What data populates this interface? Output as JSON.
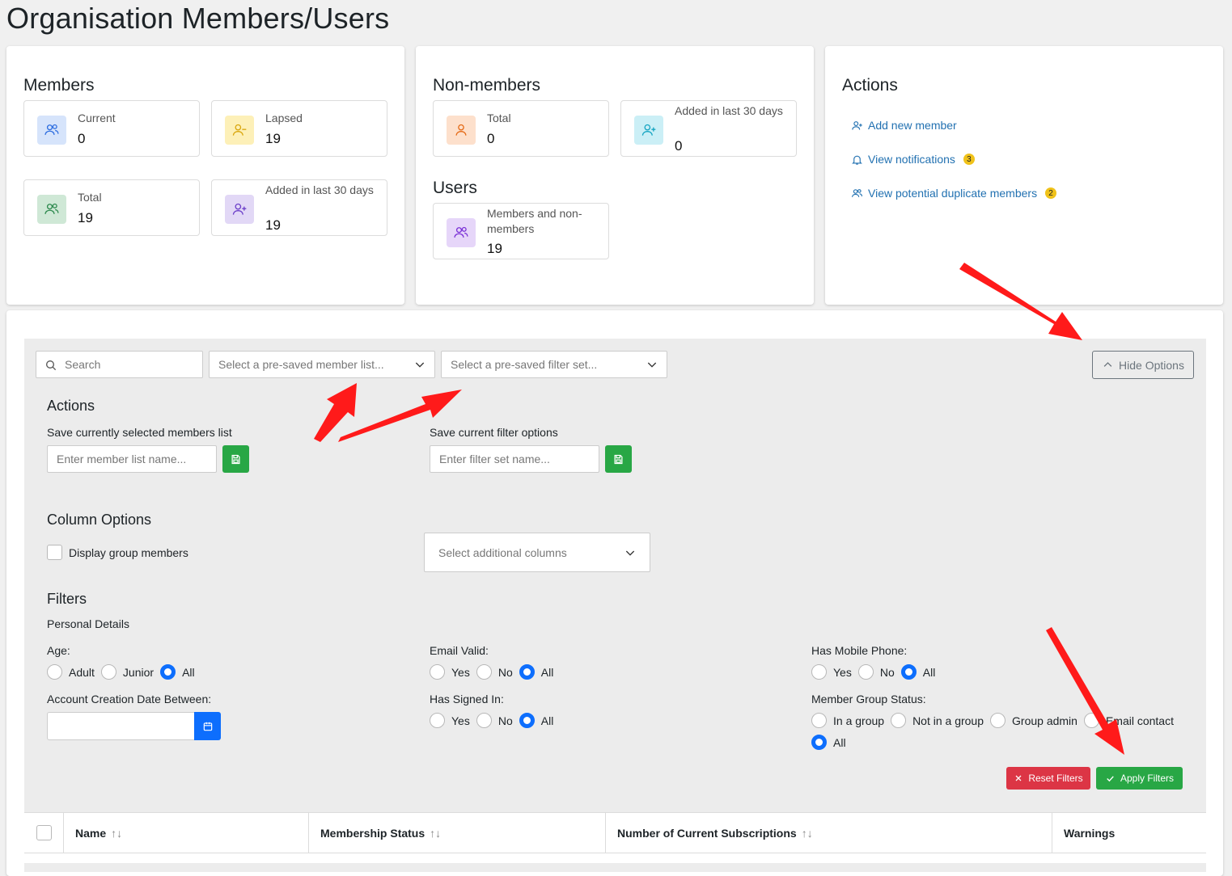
{
  "page": {
    "title": "Organisation Members/Users"
  },
  "members": {
    "heading": "Members",
    "stats": [
      {
        "label": "Current",
        "value": "0"
      },
      {
        "label": "Lapsed",
        "value": "19"
      },
      {
        "label": "Total",
        "value": "19"
      },
      {
        "label": "Added in last 30 days",
        "value": "19"
      }
    ]
  },
  "nonmembers": {
    "heading": "Non-members",
    "stats": [
      {
        "label": "Total",
        "value": "0"
      },
      {
        "label": "Added in last 30 days",
        "value": "0"
      }
    ]
  },
  "users": {
    "heading": "Users",
    "stats": [
      {
        "label": "Members and non-members",
        "value": "19"
      }
    ]
  },
  "actions_card": {
    "heading": "Actions",
    "links": [
      {
        "label": "Add new member",
        "icon": "user-plus-icon",
        "badge": ""
      },
      {
        "label": "View notifications",
        "icon": "bell-icon",
        "badge": "3"
      },
      {
        "label": "View potential duplicate members",
        "icon": "users-icon",
        "badge": "2"
      }
    ]
  },
  "toolbar": {
    "search_placeholder": "Search",
    "member_list_placeholder": "Select a pre-saved member list...",
    "filter_set_placeholder": "Select a pre-saved filter set...",
    "hide_options_label": "Hide Options"
  },
  "options": {
    "actions_heading": "Actions",
    "save_members_label": "Save currently selected members list",
    "member_list_name_placeholder": "Enter member list name...",
    "save_filter_label": "Save current filter options",
    "filter_set_name_placeholder": "Enter filter set name...",
    "column_heading": "Column Options",
    "display_group_members_label": "Display group members",
    "additional_columns_placeholder": "Select additional columns",
    "filters_heading": "Filters",
    "personal_details_label": "Personal Details"
  },
  "filters": {
    "age": {
      "label": "Age:",
      "options": [
        "Adult",
        "Junior",
        "All"
      ],
      "selected": "All"
    },
    "email_valid": {
      "label": "Email Valid:",
      "options": [
        "Yes",
        "No",
        "All"
      ],
      "selected": "All"
    },
    "mobile": {
      "label": "Has Mobile Phone:",
      "options": [
        "Yes",
        "No",
        "All"
      ],
      "selected": "All"
    },
    "creation_date": {
      "label": "Account Creation Date Between:"
    },
    "signed_in": {
      "label": "Has Signed In:",
      "options": [
        "Yes",
        "No",
        "All"
      ],
      "selected": "All"
    },
    "group_status": {
      "label": "Member Group Status:",
      "options": [
        "In a group",
        "Not in a group",
        "Group admin",
        "Email contact",
        "All"
      ],
      "selected": "All"
    },
    "reset_label": "Reset Filters",
    "apply_label": "Apply Filters"
  },
  "table": {
    "columns": [
      "Name",
      "Membership Status",
      "Number of Current Subscriptions",
      "Warnings"
    ]
  },
  "colors": {
    "link": "#2271b1",
    "primary": "#0d6efd",
    "success": "#28a745",
    "danger": "#dc3545",
    "annotation_arrow": "#ff1a1a"
  }
}
